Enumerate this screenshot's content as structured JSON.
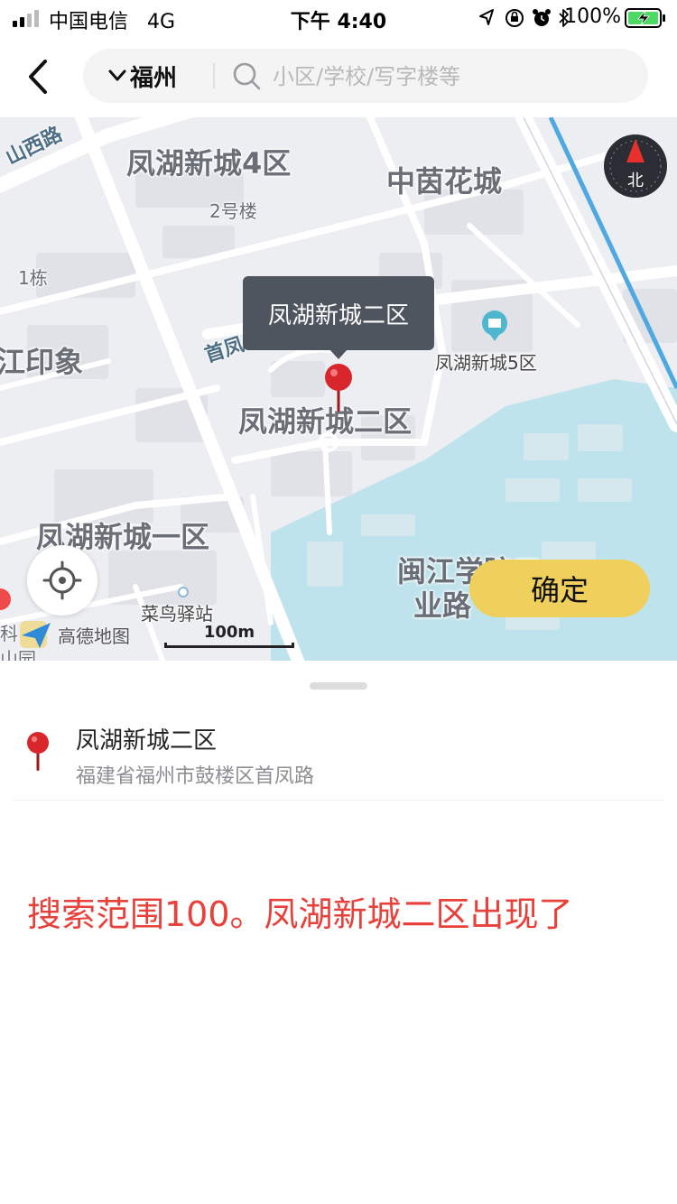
{
  "status_bar": {
    "carrier": "中国电信",
    "network": "4G",
    "time": "下午 4:40",
    "battery": "100%"
  },
  "header": {
    "city": "福州",
    "search_placeholder": "小区/学校/写字楼等"
  },
  "map": {
    "labels": {
      "district_4": "凤湖新城4区",
      "zhongyin": "中茵花城",
      "building_2": "2号楼",
      "building_1": "1栋",
      "jiangyin": "江印象",
      "district_5": "凤湖新城5区",
      "district_2": "凤湖新城二区",
      "district_1": "凤湖新城一区",
      "minjiang_1": "闽江学院工",
      "minjiang_2": "业路",
      "cainiao": "菜鸟驿站",
      "partial_1": "科",
      "partial_2": "山园"
    },
    "roads": {
      "shanxi": "山西路",
      "shoufeng": "首凤"
    },
    "callout": "凤湖新城二区",
    "compass": "北",
    "confirm": "确定",
    "brand": "高德地图",
    "scale": "100m",
    "colors": {
      "water": "#bfe3ec",
      "road": "#ffffff",
      "block": "#e0e2e7",
      "accent": "#f0d05c",
      "pin": "#d8262c"
    }
  },
  "result": {
    "title": "凤湖新城二区",
    "address": "福建省福州市鼓楼区首凤路"
  },
  "annotation": "搜索范围100。凤湖新城二区出现了"
}
